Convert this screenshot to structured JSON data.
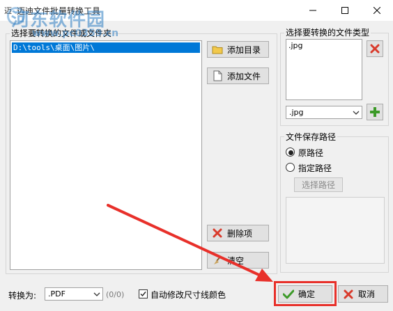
{
  "window": {
    "title": "迈迪文件批量转换工具",
    "app_icon": "迈"
  },
  "watermark": {
    "text": "河东软件园",
    "url": "www.pc0359.cn"
  },
  "left_panel": {
    "group_label": "选择要转换的文件或文件夹",
    "files": [
      "D:\\tools\\桌面\\图片\\"
    ],
    "add_folder_label": "添加目录",
    "add_file_label": "添加文件",
    "delete_label": "删除项",
    "clear_label": "清空"
  },
  "type_panel": {
    "group_label": "选择要转换的文件类型",
    "types": [
      ".jpg"
    ],
    "selected_type": ".jpg"
  },
  "save_panel": {
    "group_label": "文件保存路径",
    "original_label": "原路径",
    "specify_label": "指定路径",
    "choose_path_label": "选择路径",
    "selected": "原路径"
  },
  "bottom": {
    "convert_label": "转换为:",
    "format_value": ".PDF",
    "progress": "(0/0)",
    "auto_fix_label": "自动修改尺寸线颜色",
    "auto_fix_checked": true,
    "ok_label": "确定",
    "cancel_label": "取消"
  },
  "colors": {
    "highlight": "#e8302a",
    "selection": "#0078d7",
    "check_green": "#3c9a28",
    "delete_red": "#d93a2b"
  }
}
